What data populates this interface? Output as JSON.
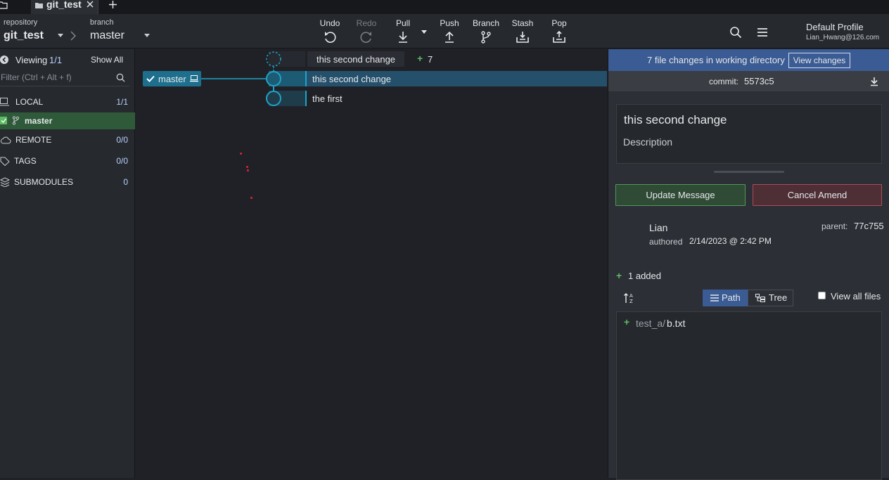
{
  "tabs": [
    {
      "label": "git_test"
    }
  ],
  "toolbar": {
    "repository_caption": "repository",
    "repository_name": "git_test",
    "branch_caption": "branch",
    "branch_name": "master",
    "undo": "Undo",
    "redo": "Redo",
    "pull": "Pull",
    "push": "Push",
    "branch": "Branch",
    "stash": "Stash",
    "pop": "Pop",
    "profile_name": "Default Profile",
    "profile_email": "Lian_Hwang@126.com"
  },
  "leftpanel": {
    "viewing_label": "Viewing",
    "viewing_count": "1/1",
    "show_all": "Show All",
    "filter_placeholder": "Filter (Ctrl + Alt + f)",
    "sections": [
      {
        "label": "LOCAL",
        "count": "1/1"
      },
      {
        "label": "REMOTE",
        "count": "0/0"
      },
      {
        "label": "TAGS",
        "count": "0/0"
      },
      {
        "label": "SUBMODULES",
        "count": "0"
      }
    ],
    "local_branch": "master"
  },
  "graph": {
    "wip_message": "this second change",
    "wip_count": "7",
    "branch_label": "master",
    "commits": [
      {
        "message": "this second change"
      },
      {
        "message": "the first"
      }
    ]
  },
  "rightpanel": {
    "wip_text": "7 file changes in working directory",
    "view_changes": "View changes",
    "commit_label": "commit:",
    "commit_sha": "5573c5",
    "summary": "this second change",
    "description_placeholder": "Description",
    "update_message": "Update Message",
    "cancel_amend": "Cancel Amend",
    "author": "Lian",
    "authored_label": "authored",
    "authored_date": "2/14/2023 @ 2:42 PM",
    "parent_label": "parent:",
    "parent_sha": "77c755",
    "added_summary": "1 added",
    "path_label": "Path",
    "tree_label": "Tree",
    "view_all_files": "View all files",
    "file_dir": "test_a/",
    "file_name": "b.txt"
  },
  "colors": {
    "accent_blue": "#3a5b93",
    "graph_cyan": "#1fa3c9",
    "added_green": "#5dbb63",
    "selected_row": "#25506b",
    "branch_badge": "#1d6f8d"
  }
}
